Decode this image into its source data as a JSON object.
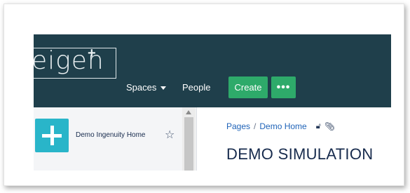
{
  "header": {
    "logo_text": "eigen",
    "logo_superscript": "+",
    "nav": {
      "spaces_label": "Spaces",
      "people_label": "People"
    },
    "create_label": "Create",
    "more_label": "•••",
    "bg_color": "#1f3f4b",
    "accent_color": "#2eaa6a"
  },
  "sidebar": {
    "space_name": "Demo Ingenuity Home",
    "space_icon": "plus-icon",
    "star_icon": "star-icon",
    "icon_color": "#29b5c9"
  },
  "content": {
    "breadcrumb": {
      "item1": "Pages",
      "separator": "/",
      "item2": "Demo Home"
    },
    "lock_icon": "lock-open-icon",
    "attachment_icon": "paperclip-icon",
    "title": "DEMO SIMULATION"
  }
}
